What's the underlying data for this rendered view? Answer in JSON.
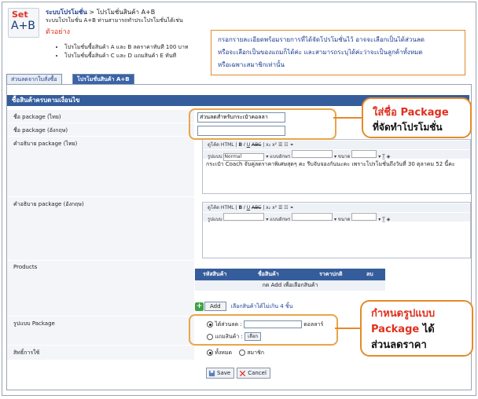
{
  "logo": {
    "line1": "Set",
    "line2": "A+B"
  },
  "breadcrumb": {
    "section": "ระบบโปรโมชั่น",
    "separator": " > ",
    "page": "โปรโมชั่นสินค้า A+B"
  },
  "description": "ระบบโปรโมชั่น A+B ท่านสามารถทำประโปรโมชั่นได้เช่น",
  "example_label": "ตัวอย่าง",
  "examples": [
    "โปรโมชั่นซื้อสินค้า A และ B ลดราคาทันที 100 บาท",
    "โปรโมชั่นซื้อสินค้า C และ D แถมสินค้า E ทันที"
  ],
  "info_box": {
    "lines": [
      "กรอกรายละเอียดพร้อมรายการที่ได้จัดโปรโมชั่นไว้ อาจจะเลือกเป็นได้ส่วนลด",
      "หรือจะเลือกเป็นของแถมก็ได้ค่ะ และสามารถระบุได้ค่ะว่าจะเป็นลูกค้าทั้งหมด",
      "หรือเฉพาะสมาชิกเท่านั้น"
    ]
  },
  "tabs": [
    {
      "label": "ส่วนลดจากใบสั่งซื้อ",
      "active": false
    },
    {
      "label": "โปรโมชั่นสินค้า A+B",
      "active": true
    }
  ],
  "form": {
    "section_title": "ซื้อสินค้าครบตามเงื่อนไข",
    "package_name_th": {
      "label": "ชื่อ package (ไทย)",
      "value": "ส่วนลดสำหรับกระเป๋าคอลลา"
    },
    "package_name_en": {
      "label": "ชื่อ package (อังกฤษ)",
      "value": ""
    },
    "desc_th": {
      "label": "คำอธิบาย package (ไทย)",
      "text": "กระเป๋า Coach จับคู่ลดราคาพิเศษสุดๆ คะ รีบจับจองกันนะคะ เพราะโปรโมชั่นถึงวันที่ 30 ตุลาคม 52 นี้คะ"
    },
    "desc_en": {
      "label": "คำอธิบาย package (อังกฤษ)",
      "text": ""
    },
    "editor_toolbar": {
      "source": "ดูโค้ด HTML",
      "bold": "B",
      "italic": "I",
      "underline": "U",
      "strike": "ABC",
      "sub": "x₂",
      "sup": "x²",
      "format_label": "รูปแบบ",
      "format_value": "Normal",
      "font_label": "แบบอักษร",
      "size_label": "ขนาด"
    },
    "products": {
      "label": "Products",
      "columns": [
        "รหัสสินค้า",
        "ชื่อสินค้า",
        "ราคาปกติ",
        "ลบ"
      ],
      "empty_text": "กด Add เพื่อเลือกสินค้า",
      "add_label": "Add",
      "add_note": "เลือกสินค้าได้ไม่เกิน 4 ชิ้น"
    },
    "package_type": {
      "label": "รูปแบบ Package",
      "discount_label": "ได้ส่วนลด :",
      "discount_unit": "ดอลลาร์",
      "gift_label": "แถมสินค้า :",
      "choose_label": "เลือก",
      "selected": "discount"
    },
    "rights": {
      "label": "สิทธิ์การใช้",
      "options": [
        "ทั้งหมด",
        "สมาชิก"
      ],
      "selected": "ทั้งหมด"
    },
    "save_label": "Save",
    "cancel_label": "Cancel"
  },
  "callouts": {
    "c1": {
      "text_red": "ใส่ชื่อ Package",
      "text_black": "ที่จัดทำโปรโมชั่น"
    },
    "c2": {
      "text_red1": "กำหนดรูปแบบ",
      "text_red2": "Package",
      "text_black2": " ได้",
      "text_black3": "ส่วนลดราคา"
    }
  },
  "colors": {
    "header_blue": "#355d9c",
    "callout_orange": "#e58a2a",
    "accent_red": "#e0301e"
  }
}
